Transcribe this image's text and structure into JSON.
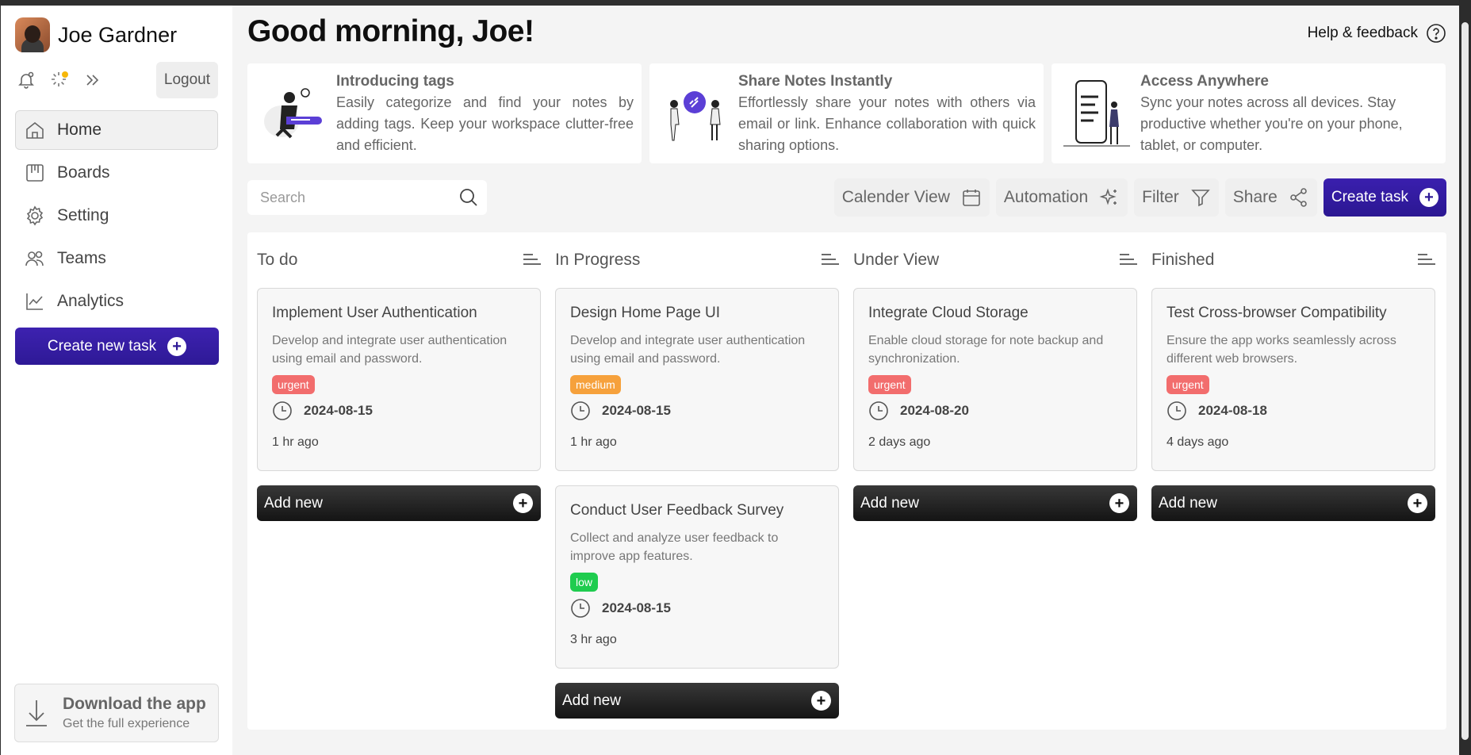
{
  "user": {
    "name": "Joe Gardner"
  },
  "sidebar": {
    "logout_label": "Logout",
    "nav": [
      {
        "label": "Home",
        "icon": "home-icon",
        "active": true
      },
      {
        "label": "Boards",
        "icon": "boards-icon"
      },
      {
        "label": "Setting",
        "icon": "gear-icon"
      },
      {
        "label": "Teams",
        "icon": "teams-icon"
      },
      {
        "label": "Analytics",
        "icon": "analytics-icon"
      }
    ],
    "create_label": "Create new task",
    "download": {
      "title": "Download the app",
      "subtitle": "Get the full experience"
    }
  },
  "header": {
    "greeting": "Good morning, Joe!",
    "help_label": "Help & feedback"
  },
  "promos": [
    {
      "title": "Introducing tags",
      "text": "Easily categorize and find your notes by adding tags. Keep your workspace clutter-free and efficient."
    },
    {
      "title": "Share Notes Instantly",
      "text": "Effortlessly share your notes with others via email or link. Enhance collaboration with quick sharing options."
    },
    {
      "title": "Access Anywhere",
      "text": "Sync your notes across all devices. Stay productive whether you're on your phone, tablet, or computer."
    }
  ],
  "search": {
    "placeholder": "Search"
  },
  "toolbar": {
    "calendar": "Calender View",
    "automation": "Automation",
    "filter": "Filter",
    "share": "Share",
    "create": "Create task"
  },
  "add_new_label": "Add new",
  "columns": [
    {
      "title": "To do",
      "cards": [
        {
          "title": "Implement User Authentication",
          "desc": "Develop and integrate user authentication using email and password.",
          "tag": "urgent",
          "date": "2024-08-15",
          "ago": "1 hr ago"
        }
      ]
    },
    {
      "title": "In Progress",
      "cards": [
        {
          "title": "Design Home Page UI",
          "desc": "Develop and integrate user authentication using email and password.",
          "tag": "medium",
          "date": "2024-08-15",
          "ago": "1 hr ago"
        },
        {
          "title": "Conduct User Feedback Survey",
          "desc": "Collect and analyze user feedback to improve app features.",
          "tag": "low",
          "date": "2024-08-15",
          "ago": "3 hr ago"
        }
      ]
    },
    {
      "title": "Under View",
      "cards": [
        {
          "title": "Integrate Cloud Storage",
          "desc": "Enable cloud storage for note backup and synchronization.",
          "tag": "urgent",
          "date": "2024-08-20",
          "ago": "2 days ago"
        }
      ]
    },
    {
      "title": "Finished",
      "cards": [
        {
          "title": "Test Cross-browser Compatibility",
          "desc": "Ensure the app works seamlessly across different web browsers.",
          "tag": "urgent",
          "date": "2024-08-18",
          "ago": "4 days ago"
        }
      ]
    }
  ],
  "colors": {
    "primary": "#2e1996",
    "urgent": "#f26d6d",
    "medium": "#f6a13c",
    "low": "#1fcc4f"
  }
}
